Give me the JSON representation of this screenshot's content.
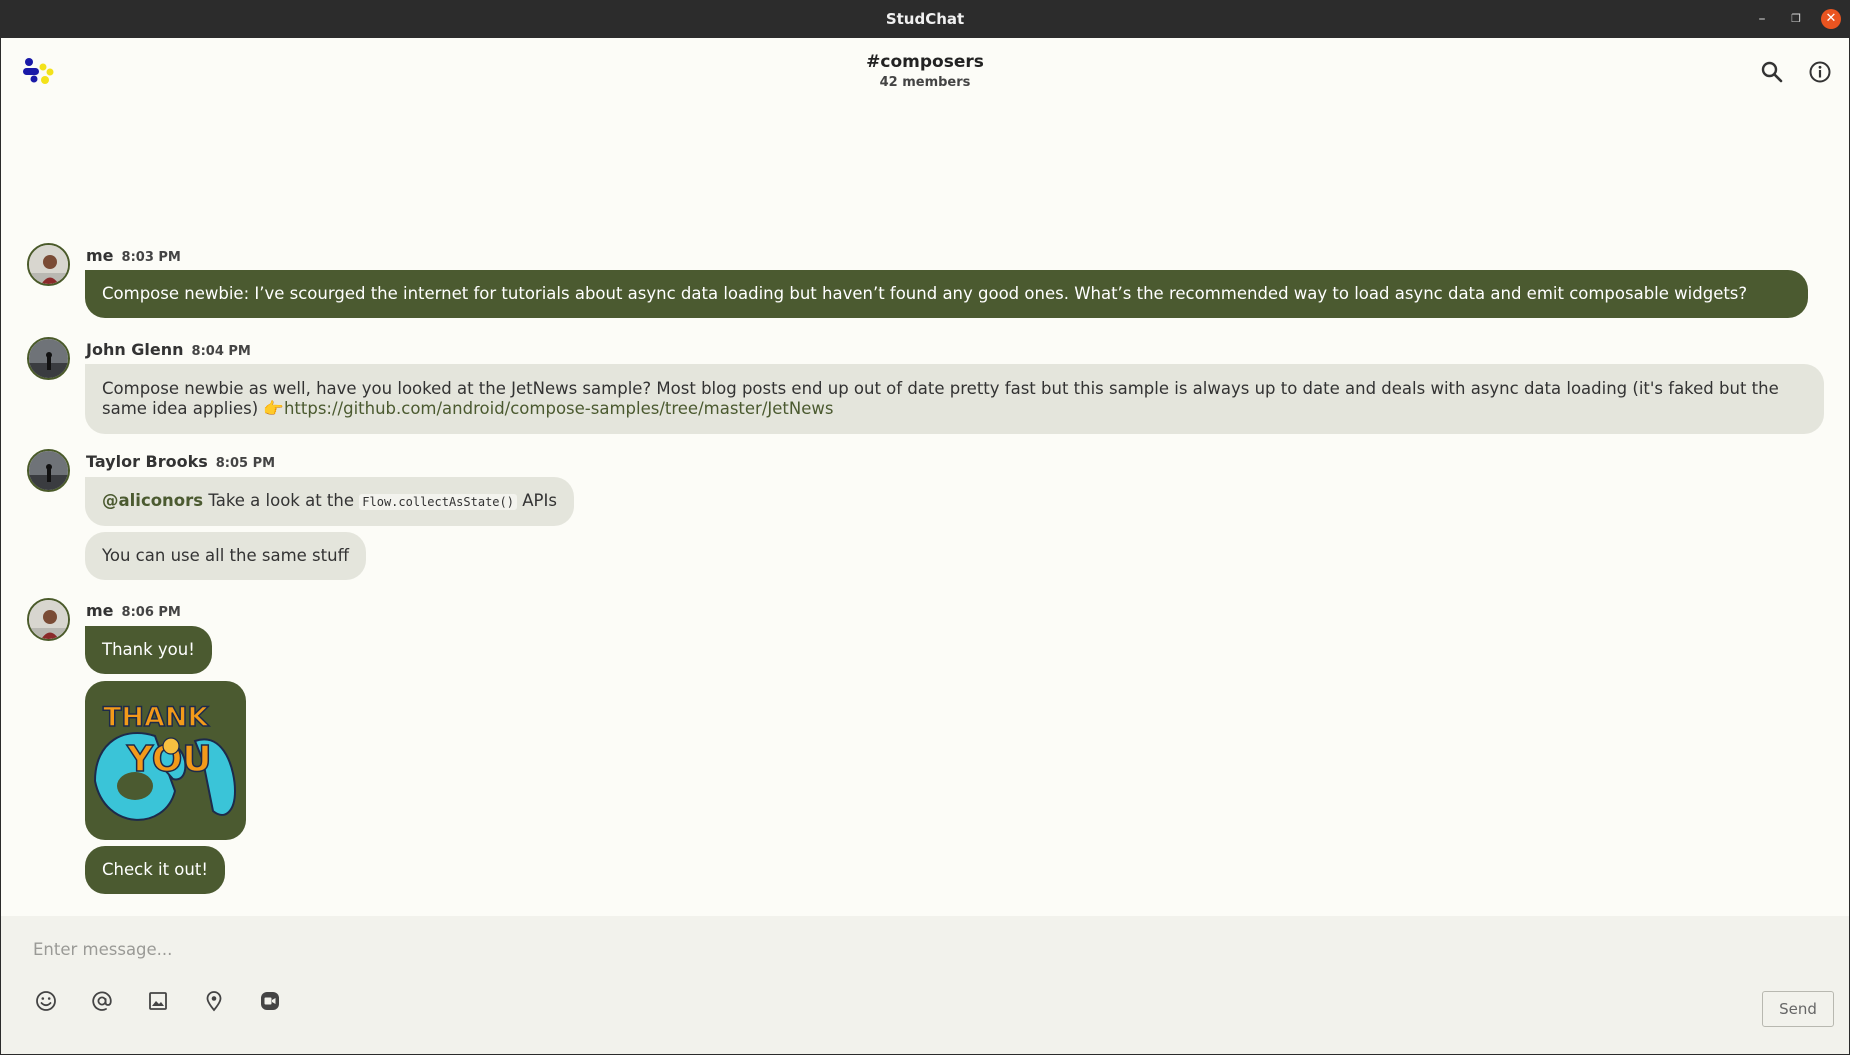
{
  "window": {
    "title": "StudChat",
    "min_glyph": "–",
    "max_glyph": "❐",
    "close_glyph": "✕"
  },
  "header": {
    "channel": "#composers",
    "members": "42 members"
  },
  "messages": [
    {
      "author": "me",
      "time": "8:03 PM",
      "text": "Compose newbie: I’ve scourged the internet for tutorials about async data loading but haven’t found any good ones. What’s the recommended way to load async data and emit composable widgets?"
    },
    {
      "author": "John Glenn",
      "time": "8:04 PM",
      "text": "Compose newbie as well, have you looked at the JetNews sample? Most blog posts end up out of date pretty fast but this sample is always up to date and deals with async data loading (it's faked but the same idea applies) 👉",
      "link": "https://github.com/android/compose-samples/tree/master/JetNews"
    },
    {
      "author": "Taylor Brooks",
      "time": "8:05 PM",
      "mention": "@aliconors",
      "text_before": "Take a look at the",
      "code": "Flow.collectAsState()",
      "text_after": "APIs",
      "followup": "You can use all the same stuff"
    },
    {
      "author": "me",
      "time": "8:06 PM",
      "text": "Thank you!",
      "sticker_text": "THANK YOU",
      "followup": "Check it out!"
    }
  ],
  "composer": {
    "placeholder": "Enter message...",
    "send_label": "Send"
  },
  "colors": {
    "accent": "#4b5a30",
    "background": "#fcfcf7",
    "bubble_other": "#e4e5dc"
  }
}
